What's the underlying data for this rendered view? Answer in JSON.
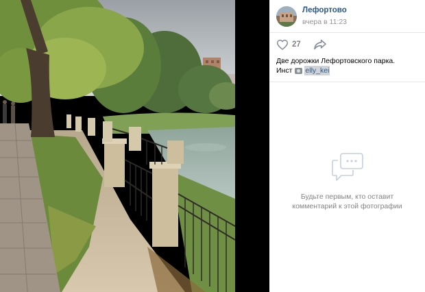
{
  "post": {
    "author_name": "Лефортово",
    "time": "вчера в 11:23",
    "likes": "27",
    "caption_line1": "Две дорожки Лефортовского парка.",
    "caption_line2_prefix": "Инст",
    "instagram_handle": "elly_kei"
  },
  "comments": {
    "empty_line1": "Будьте первым, кто оставит",
    "empty_line2": "комментарий к этой фотографии"
  },
  "colors": {
    "link": "#2a5885",
    "muted": "#828282",
    "timestamp": "#939393"
  },
  "icons": {
    "like": "heart-outline-icon",
    "share": "share-arrow-icon",
    "comments_empty": "speech-bubbles-icon"
  }
}
